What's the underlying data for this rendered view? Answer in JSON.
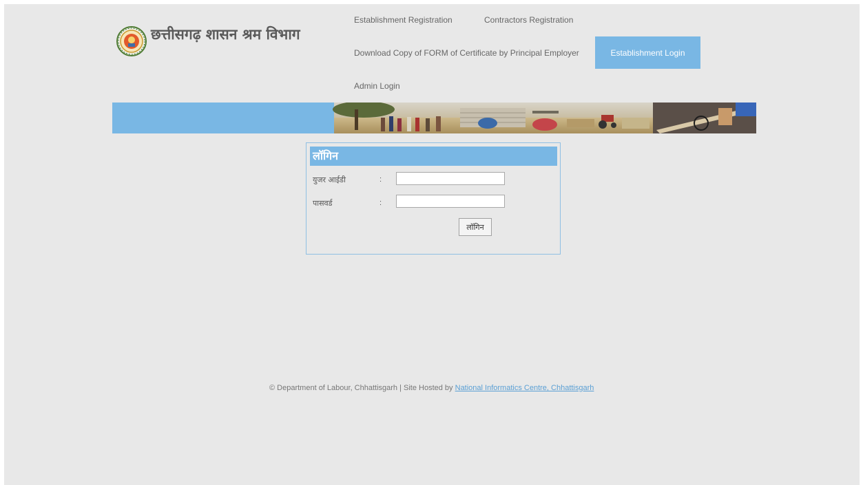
{
  "header": {
    "title": "छत्तीसगढ़ शासन श्रम विभाग",
    "emblem": "chhattisgarh-state-emblem"
  },
  "nav": {
    "establishment_registration": "Establishment Registration",
    "contractors_registration": "Contractors Registration",
    "download_certificate": "Download Copy of FORM of Certificate by Principal Employer",
    "establishment_login": "Establishment Login",
    "admin_login": "Admin Login"
  },
  "login": {
    "title": "लॉगिन",
    "user_id_label": "युजर आईडी",
    "password_label": "पासवर्ड",
    "colon": ":",
    "user_id_value": "",
    "password_value": "",
    "button_label": "लॉगिन"
  },
  "footer": {
    "text": "© Department of Labour, Chhattisgarh | Site Hosted by",
    "link_text": "National Informatics Centre, Chhattisgarh"
  },
  "colors": {
    "accent": "#79b7e4",
    "page_background": "#e8e8e8",
    "text": "#666666"
  }
}
